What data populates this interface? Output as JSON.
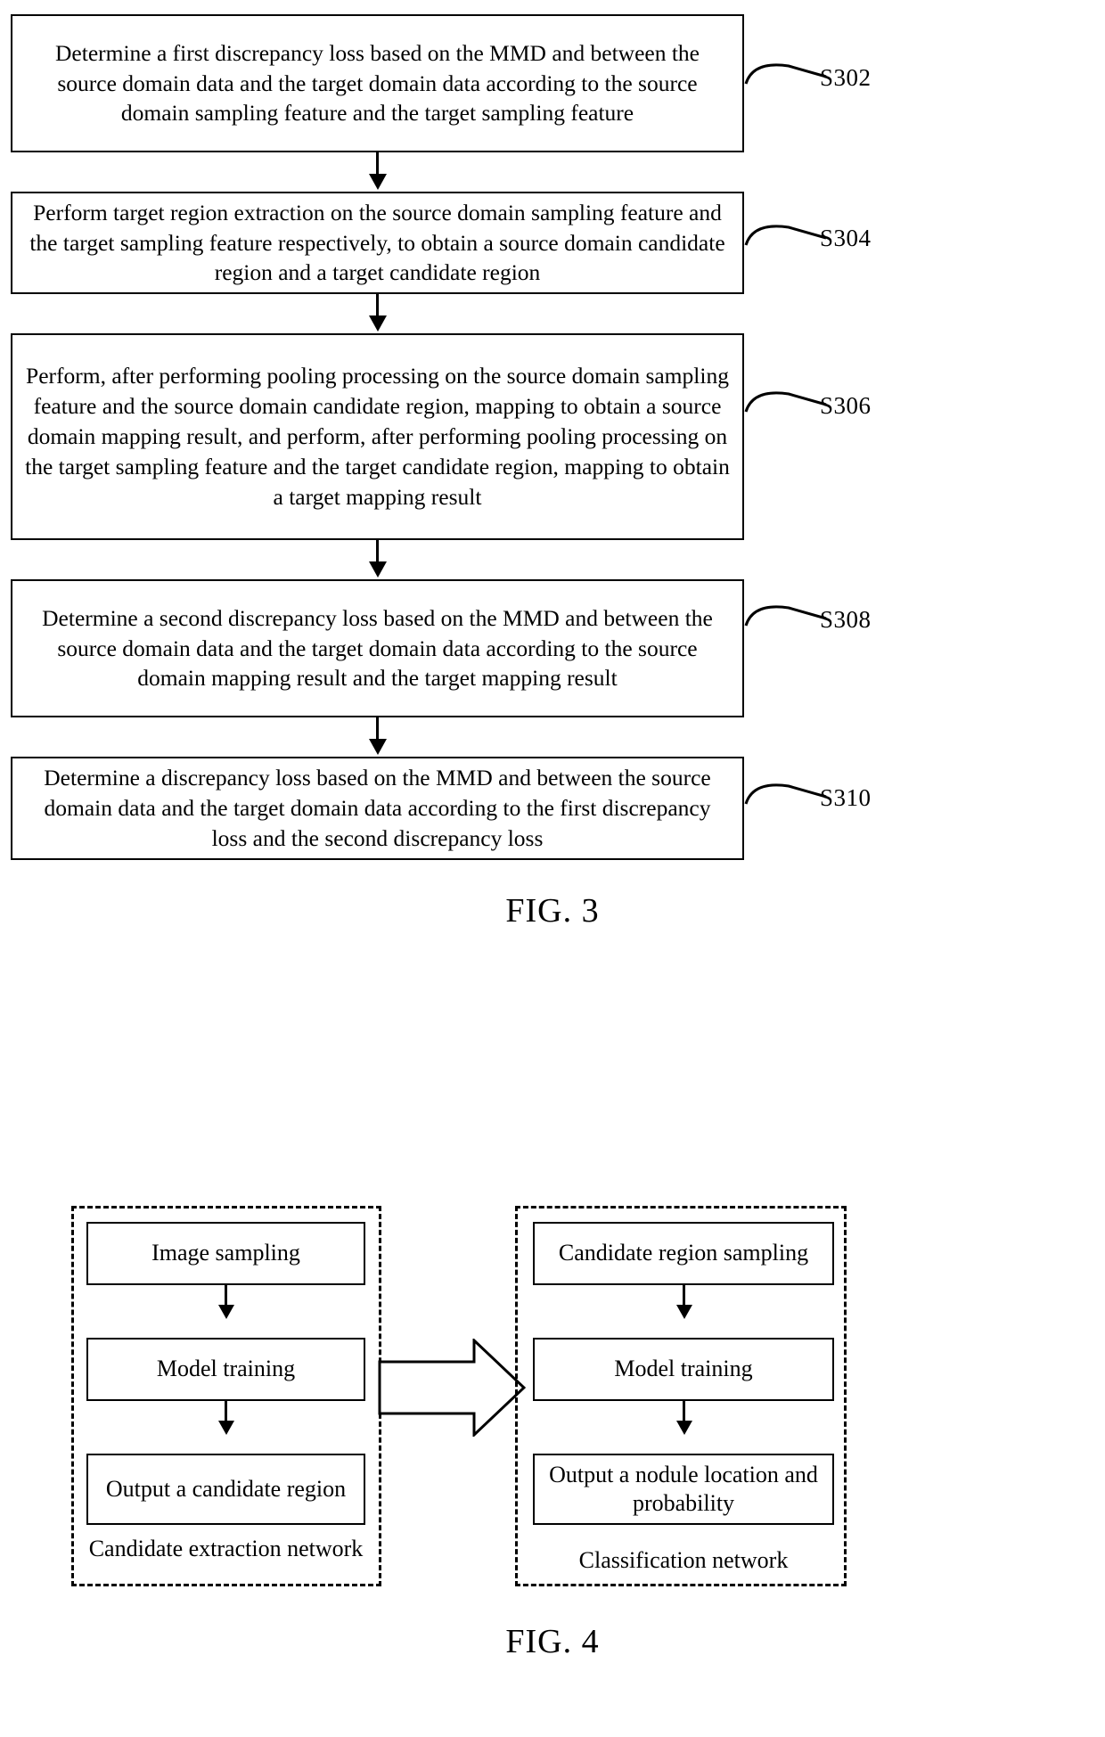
{
  "figure3": {
    "caption": "FIG. 3",
    "steps": [
      {
        "id": "S302",
        "text": "Determine a first discrepancy loss based on the MMD and between the source domain data and the target domain data according to the source domain sampling feature and the target sampling feature"
      },
      {
        "id": "S304",
        "text": "Perform target region extraction on the source domain sampling feature and the target sampling feature respectively, to obtain a source domain candidate region and a target candidate region"
      },
      {
        "id": "S306",
        "text": "Perform, after performing pooling processing on the source domain sampling feature and the source domain candidate region, mapping to obtain a source domain mapping result, and perform, after performing pooling processing on the target sampling feature and the target candidate region, mapping to obtain a target mapping result"
      },
      {
        "id": "S308",
        "text": "Determine a second discrepancy loss based on the MMD and between the source domain data and the target domain data according to the source domain mapping result and the target mapping result"
      },
      {
        "id": "S310",
        "text": "Determine a discrepancy loss based on the MMD and between the source domain data and the target domain data according to the first discrepancy loss and the second discrepancy loss"
      }
    ]
  },
  "figure4": {
    "caption": "FIG. 4",
    "left_panel": {
      "label": "Candidate extraction network",
      "boxes": [
        {
          "text": "Image sampling"
        },
        {
          "text": "Model training"
        },
        {
          "text": "Output a candidate region"
        }
      ]
    },
    "right_panel": {
      "label": "Classification network",
      "boxes": [
        {
          "text": "Candidate region sampling"
        },
        {
          "text": "Model training"
        },
        {
          "text": "Output a nodule location and probability"
        }
      ]
    }
  }
}
